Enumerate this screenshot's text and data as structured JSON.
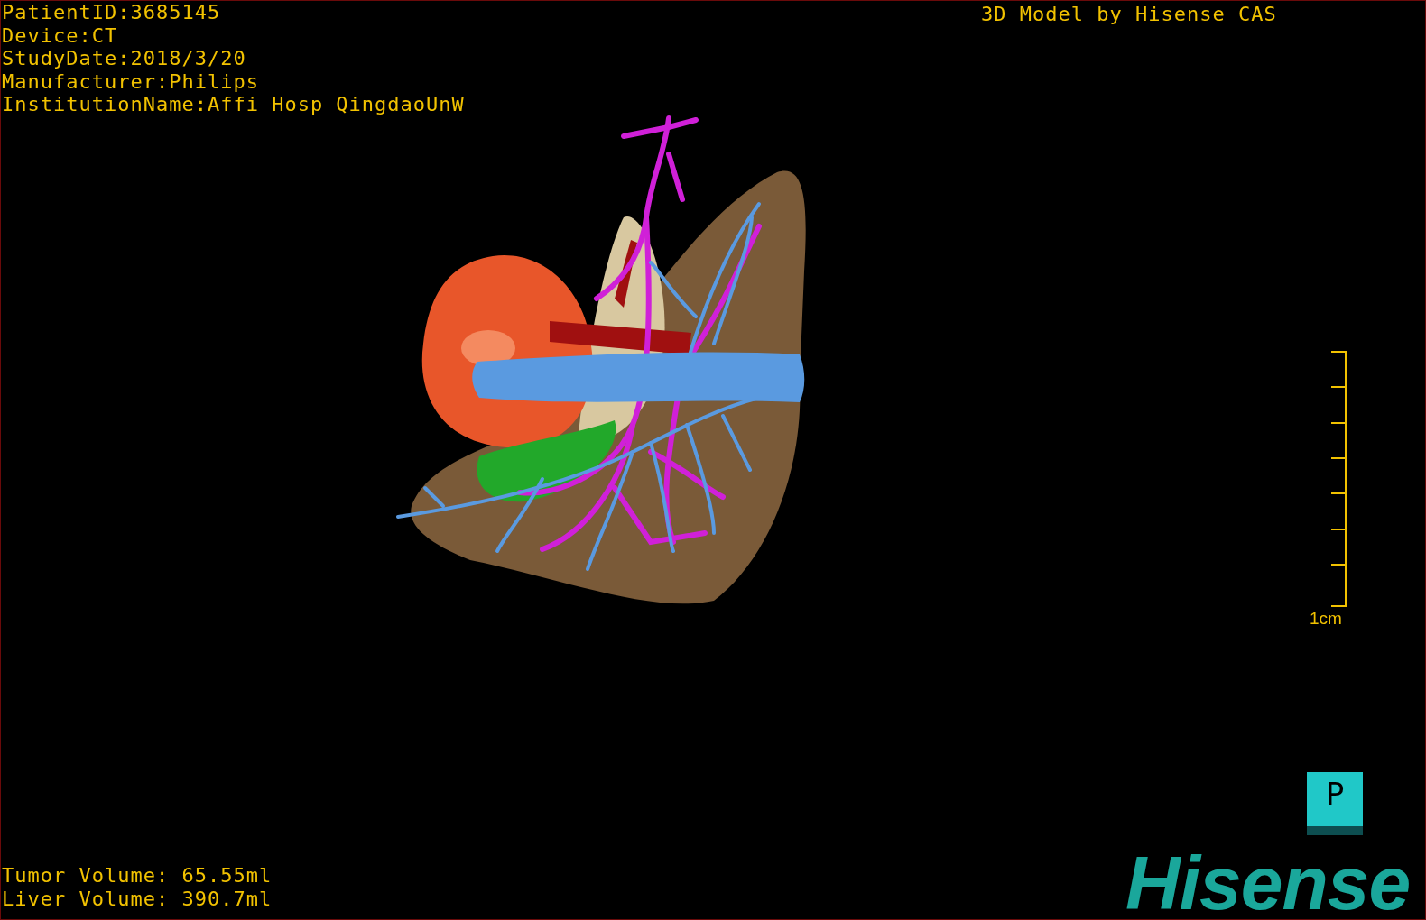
{
  "patient_info": [
    "PatientID:3685145",
    "Device:CT",
    "StudyDate:2018/3/20",
    "Manufacturer:Philips",
    "InstitutionName:Affi Hosp QingdaoUnW"
  ],
  "title": "3D Model by Hisense CAS",
  "scale_bar": {
    "label": "1cm"
  },
  "volumes": [
    "Tumor Volume: 65.55ml",
    "Liver Volume: 390.7ml"
  ],
  "orientation_cube": {
    "label": "P"
  },
  "logo": "Hisense"
}
